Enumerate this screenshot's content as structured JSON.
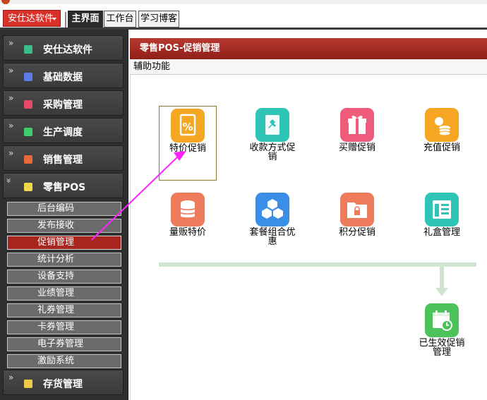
{
  "app": {
    "menu_label": "安仕达软件",
    "tabs": [
      {
        "label": "主界面",
        "active": true
      },
      {
        "label": "工作台",
        "active": false
      },
      {
        "label": "学习博客",
        "active": false
      }
    ]
  },
  "sidebar": {
    "groups": [
      {
        "label": "安仕达软件",
        "icon": "app-icon",
        "color": "#3bbf8a"
      },
      {
        "label": "基础数据",
        "icon": "database-icon",
        "color": "#5b7de8"
      },
      {
        "label": "采购管理",
        "icon": "purchase-icon",
        "color": "#e84a6a"
      },
      {
        "label": "生产调度",
        "icon": "production-icon",
        "color": "#3fcf6a"
      },
      {
        "label": "销售管理",
        "icon": "sales-icon",
        "color": "#e86a3a"
      },
      {
        "label": "零售POS",
        "icon": "pos-icon",
        "color": "#f0d84a"
      },
      {
        "label": "存货管理",
        "icon": "inventory-icon",
        "color": "#f0c84a"
      }
    ],
    "pos_subitems": [
      {
        "label": "后台编码",
        "active": false
      },
      {
        "label": "发布接收",
        "active": false
      },
      {
        "label": "促销管理",
        "active": true
      },
      {
        "label": "统计分析",
        "active": false
      },
      {
        "label": "设备支持",
        "active": false
      },
      {
        "label": "业绩管理",
        "active": false
      },
      {
        "label": "礼券管理",
        "active": false
      },
      {
        "label": "卡券管理",
        "active": false
      },
      {
        "label": "电子券管理",
        "active": false
      },
      {
        "label": "激励系统",
        "active": false
      }
    ]
  },
  "panel": {
    "title": "零售POS-促销管理",
    "subtitle": "辅助功能"
  },
  "tiles": [
    {
      "label": "特价促销",
      "icon": "percent-doc-icon",
      "color": "#f5a623"
    },
    {
      "label": "收款方式促销",
      "icon": "pin-icon",
      "color": "#2ec4b6"
    },
    {
      "label": "买赠促销",
      "icon": "gift-icon",
      "color": "#ef5b7b"
    },
    {
      "label": "充值促销",
      "icon": "coins-icon",
      "color": "#f5a623"
    },
    {
      "label": "量贩特价",
      "icon": "stack-icon",
      "color": "#ee7b5b"
    },
    {
      "label": "套餐组合优惠",
      "icon": "cubes-icon",
      "color": "#3a8ee6"
    },
    {
      "label": "积分促销",
      "icon": "folder-lock-icon",
      "color": "#ee7b5b"
    },
    {
      "label": "礼盒管理",
      "icon": "panel-icon",
      "color": "#2ec4b6"
    },
    {
      "label": "已生效促销管理",
      "icon": "calendar-clock-icon",
      "color": "#4cc25a"
    }
  ],
  "colors": {
    "accent_red": "#a8261e",
    "header_red": "#b83a30",
    "flow_green": "#cfe5d0",
    "pointer_magenta": "#ff22ff"
  }
}
